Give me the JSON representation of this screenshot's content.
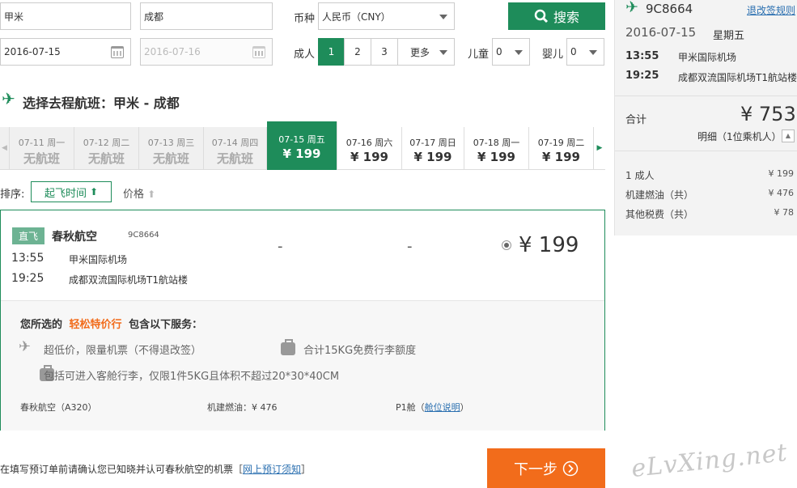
{
  "search": {
    "from_city": "甲米",
    "to_city": "成都",
    "depart_date": "2016-07-15",
    "return_date": "2016-07-16",
    "currency_label": "币种",
    "currency_value": "人民币（CNY）",
    "search_button": "搜索",
    "adult_label": "成人",
    "adult_options": [
      "1",
      "2",
      "3"
    ],
    "more_label": "更多",
    "child_label": "儿童",
    "child_value": "0",
    "infant_label": "婴儿",
    "infant_value": "0"
  },
  "section_title": "选择去程航班：甲米 - 成都",
  "date_tabs": [
    {
      "date": "07-11 周一",
      "price": "无航班"
    },
    {
      "date": "07-12 周二",
      "price": "无航班"
    },
    {
      "date": "07-13 周三",
      "price": "无航班"
    },
    {
      "date": "07-14 周四",
      "price": "无航班"
    },
    {
      "date": "07-15 周五",
      "price": "¥ 199"
    },
    {
      "date": "07-16 周六",
      "price": "¥ 199"
    },
    {
      "date": "07-17 周日",
      "price": "¥ 199"
    },
    {
      "date": "07-18 周一",
      "price": "¥ 199"
    },
    {
      "date": "07-19 周二",
      "price": "¥ 199"
    }
  ],
  "sort": {
    "label": "排序:",
    "by_time": "起飞时间",
    "by_price": "价格"
  },
  "flight": {
    "tag": "直飞",
    "airline": "春秋航空",
    "number": "9C8664",
    "dep_time": "13:55",
    "dep_airport": "甲米国际机场",
    "arr_time": "19:25",
    "arr_airport": "成都双流国际机场T1航站楼",
    "col1": "-",
    "col2": "-",
    "price": "¥ 199"
  },
  "service": {
    "prefix": "您所选的",
    "fare_name": "轻松特价行",
    "suffix": "包含以下服务：",
    "item1": "超低价，限量机票（不得退改签）",
    "item2": "合计15KG免费行李额度",
    "item3": "包括可进入客舱行李，仅限1件5KG且体积不超过20*30*40CM",
    "aircraft": "春秋航空（A320）",
    "fuel": "机建燃油：¥ 476",
    "cabin": "P1舱",
    "cabin_link": "舱位说明"
  },
  "footer": {
    "notice": "在填写预订单前请确认您已知晓并认可春秋航空的机票［",
    "notice_link": "网上预订须知",
    "notice_end": "］",
    "next_button": "下一步"
  },
  "summary": {
    "flight_no": "9C8664",
    "rules_link": "退改签规则",
    "date": "2016-07-15",
    "weekday": "星期五",
    "dep_time": "13:55",
    "dep_airport": "甲米国际机场",
    "arr_time": "19:25",
    "arr_airport": "成都双流国际机场T1航站楼",
    "total_label": "合计",
    "total": "¥ 753",
    "detail": "明细（1位乘机人）",
    "rows": [
      {
        "label": "1 成人",
        "value": "¥ 199"
      },
      {
        "label": "机建燃油（共）",
        "value": "¥ 476"
      },
      {
        "label": "其他税费（共）",
        "value": "¥ 78"
      }
    ]
  },
  "watermark": "eLvXing.net",
  "colors": {
    "brand": "#1e8c5a",
    "accent": "#f26c1b"
  }
}
